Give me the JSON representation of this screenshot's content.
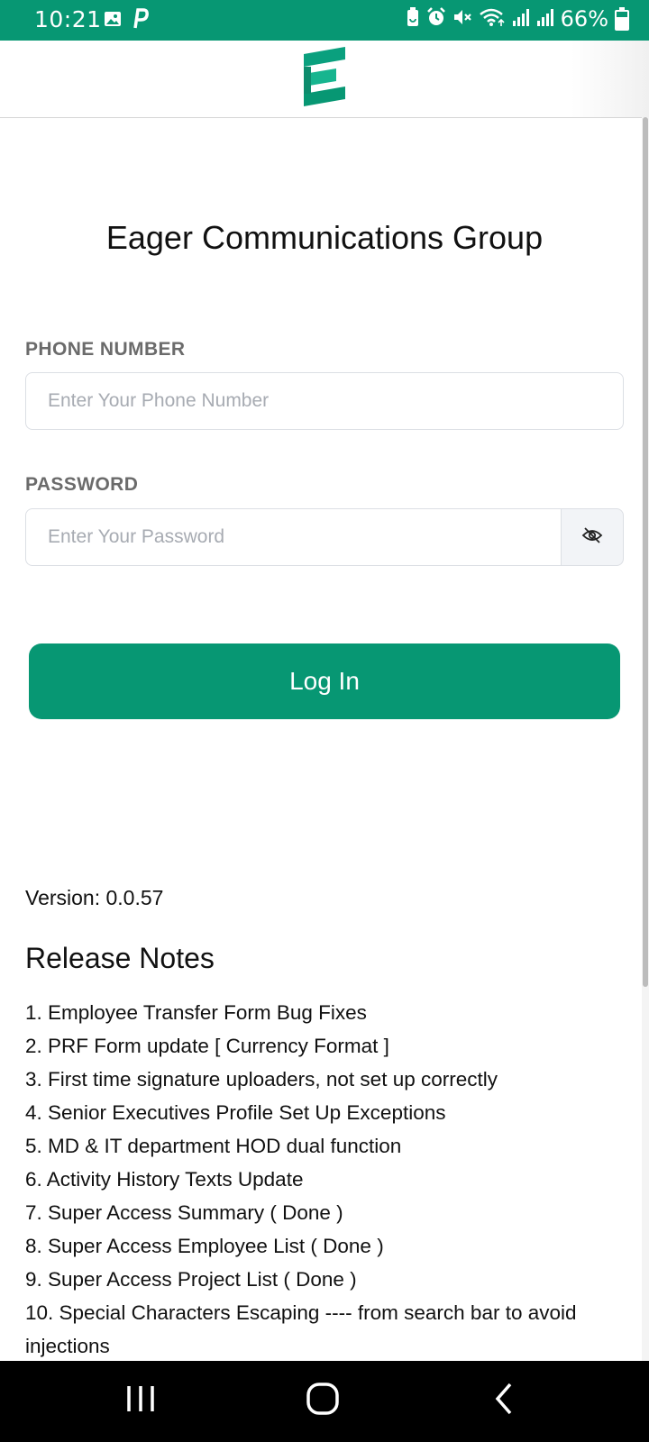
{
  "status_bar": {
    "time": "10:21",
    "battery_percent": "66%",
    "battery_level": 0.66,
    "left_icons": [
      "gallery-icon",
      "p-app-icon"
    ],
    "right_icons": [
      "battery-saver-icon",
      "alarm-icon",
      "mute-icon",
      "wifi-icon",
      "signal-icon",
      "signal-icon"
    ]
  },
  "colors": {
    "brand": "#079773",
    "background": "#ffffff",
    "label": "#6b6b6b",
    "placeholder": "#a7abb2"
  },
  "header": {
    "logo": "eager-logo-icon"
  },
  "main": {
    "title": "Eager Communications Group",
    "phone": {
      "label": "PHONE NUMBER",
      "placeholder": "Enter Your Phone Number",
      "value": ""
    },
    "password": {
      "label": "PASSWORD",
      "placeholder": "Enter Your Password",
      "value": "",
      "toggle_icon": "eye-off-icon"
    },
    "login_label": "Log In",
    "version": "Version: 0.0.57",
    "release_notes_title": "Release Notes",
    "release_notes": [
      "1. Employee Transfer Form Bug Fixes",
      "2. PRF Form update [ Currency Format ]",
      "3. First time signature uploaders, not set up correctly",
      "4. Senior Executives Profile Set Up Exceptions",
      "5. MD & IT department HOD dual function",
      "6. Activity History Texts Update",
      "7. Super Access Summary ( Done )",
      "8. Super Access Employee List ( Done )",
      "9. Super Access Project List ( Done )",
      "10. Special Characters Escaping ---- from search bar to avoid injections"
    ]
  },
  "nav_bar": {
    "buttons": [
      "recent-apps-icon",
      "home-icon",
      "back-icon"
    ]
  }
}
